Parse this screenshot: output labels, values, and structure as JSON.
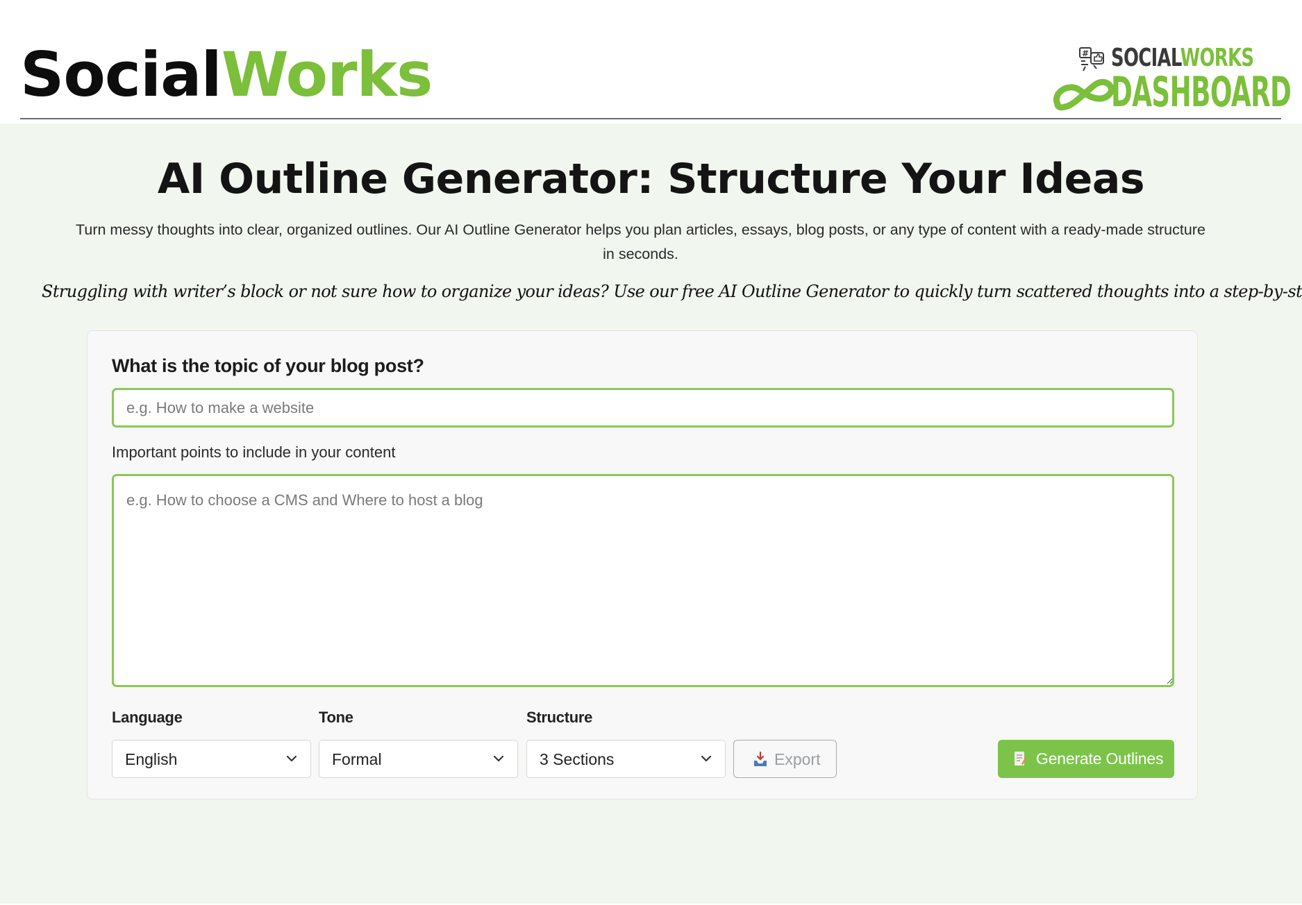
{
  "header": {
    "brand_part1": "Social",
    "brand_part2": "Works",
    "logo": {
      "line1_part1": "SOCIAL",
      "line1_part2": "WORKS",
      "line2": "DASHBOARD"
    }
  },
  "hero": {
    "title": "AI Outline Generator: Structure Your Ideas",
    "intro": "Turn messy thoughts into clear, organized outlines. Our AI Outline Generator helps you plan articles, essays, blog posts, or any type of content with a ready-made structure in seconds.",
    "tagline": "Struggling with writer’s block or not sure how to organize your ideas? Use our free AI Outline Generator to quickly turn scattered thoughts into a step-by-step plan."
  },
  "form": {
    "topic_label": "What is the topic of your blog post?",
    "topic_placeholder": "e.g. How to make a website",
    "topic_value": "",
    "points_label": "Important points to include in your content",
    "points_placeholder": "e.g. How to choose a CMS and Where to host a blog",
    "points_value": "",
    "language": {
      "label": "Language",
      "selected": "English"
    },
    "tone": {
      "label": "Tone",
      "selected": "Formal"
    },
    "structure": {
      "label": "Structure",
      "selected": "3 Sections"
    },
    "export_label": "Export",
    "generate_label": "Generate Outlines"
  },
  "colors": {
    "accent_green": "#7bbf3a",
    "button_green": "#7cc449",
    "page_background": "#f1f6ee"
  },
  "icons": {
    "export": "inbox-tray-icon",
    "generate": "memo-pencil-icon",
    "select_chevron": "chevron-down-icon",
    "logo_icons": "social-hashtag-like-icon",
    "logo_loop": "infinity-loop-icon"
  }
}
